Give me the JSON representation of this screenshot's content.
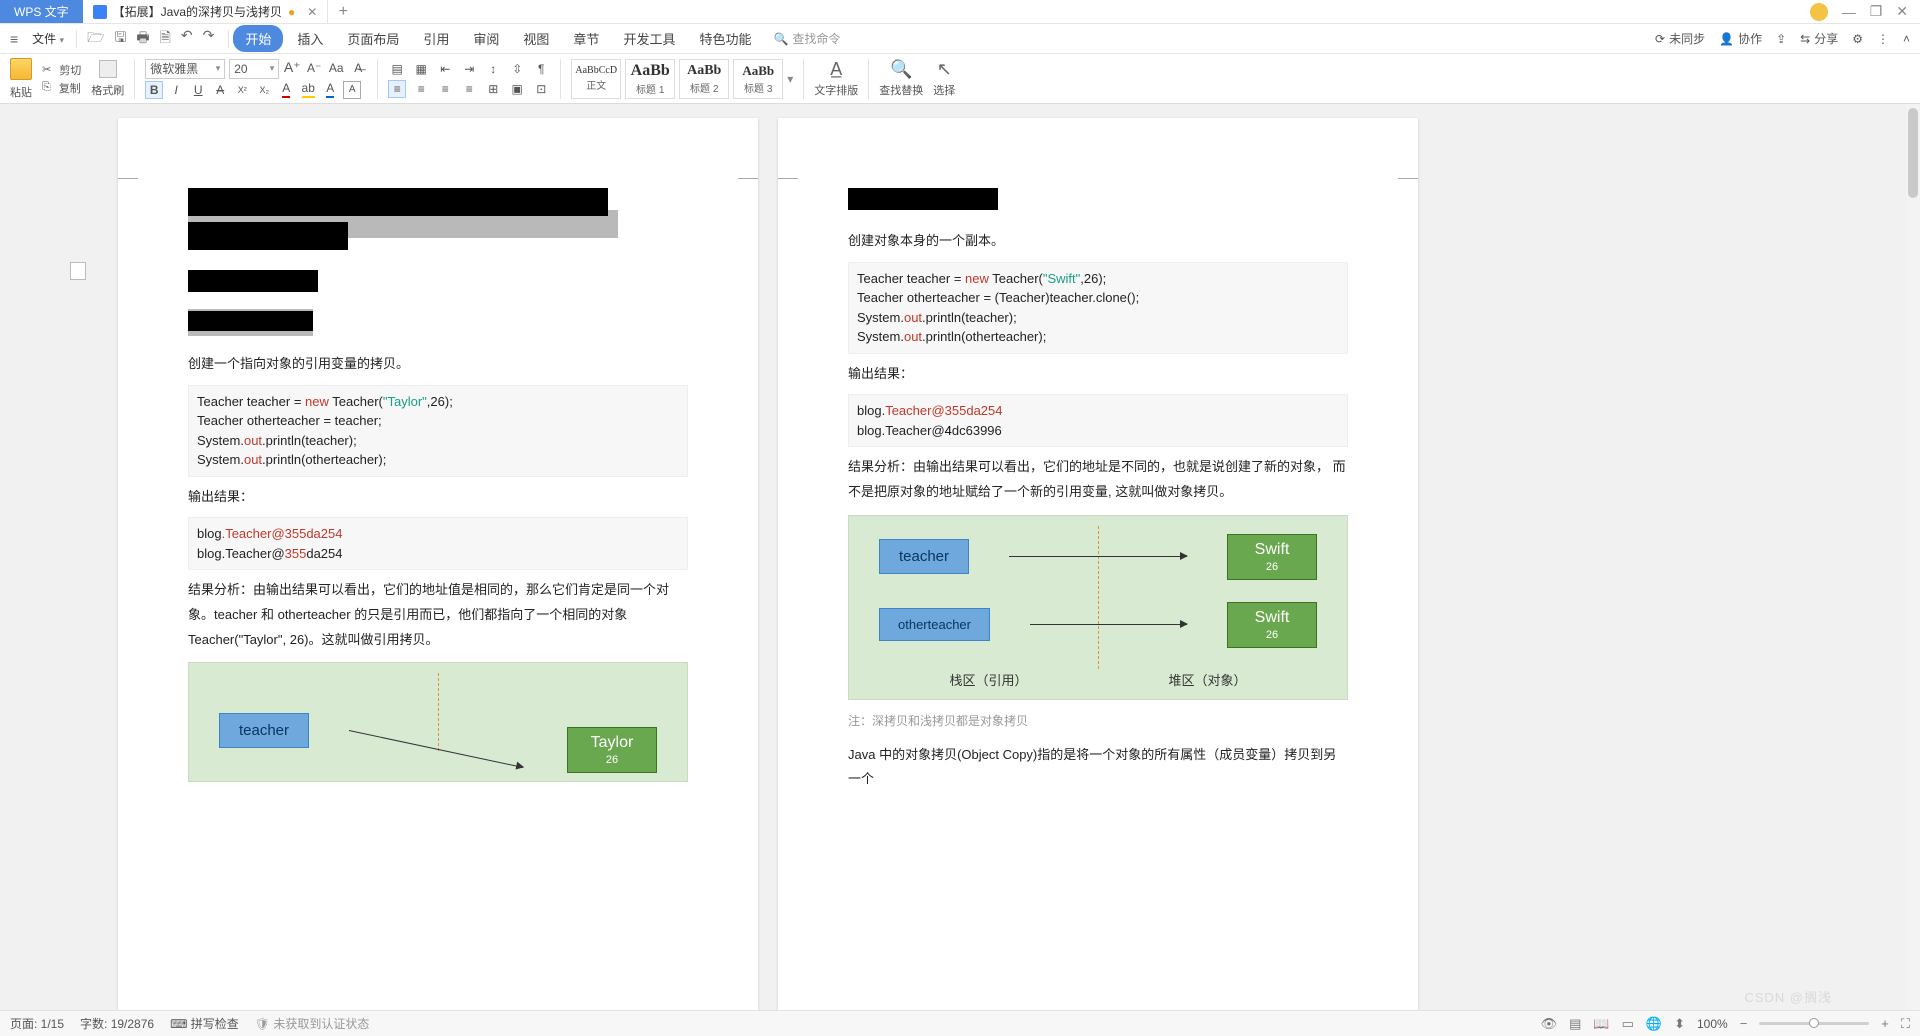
{
  "titlebar": {
    "app_name": "WPS 文字",
    "doc_title": "【拓展】Java的深拷贝与浅拷贝",
    "doc_dirty": "●"
  },
  "menubar": {
    "file": "文件",
    "tabs": [
      "开始",
      "插入",
      "页面布局",
      "引用",
      "审阅",
      "视图",
      "章节",
      "开发工具",
      "特色功能"
    ],
    "search_placeholder": "查找命令",
    "right": {
      "sync": "未同步",
      "collab": "协作",
      "share": "分享"
    }
  },
  "ribbon": {
    "paste": "粘贴",
    "cut": "剪切",
    "copy": "复制",
    "format_brush": "格式刷",
    "font_name": "微软雅黑",
    "font_size": "20",
    "styles": [
      {
        "preview": "AaBbCcD",
        "name": "正文"
      },
      {
        "preview": "AaBb",
        "name": "标题 1"
      },
      {
        "preview": "AaBb",
        "name": "标题 2"
      },
      {
        "preview": "AaBb",
        "name": "标题 3"
      }
    ],
    "text_layout": "文字排版",
    "find_replace": "查找替换",
    "select": "选择"
  },
  "doc": {
    "left": {
      "p1": "创建一个指向对象的引用变量的拷贝。",
      "code": [
        "Teacher teacher = new Teacher(\"Taylor\",26);",
        "Teacher otherteacher = teacher;",
        "System.out.println(teacher);",
        "System.out.println(otherteacher);"
      ],
      "out_label": "输出结果：",
      "out": [
        "blog.Teacher@355da254",
        "blog.Teacher@355da254"
      ],
      "analysis": "结果分析：由输出结果可以看出，它们的地址值是相同的，那么它们肯定是同一个对象。teacher 和 otherteacher 的只是引用而已，他们都指向了一个相同的对象 Teacher(\"Taylor\", 26)。这就叫做引用拷贝。",
      "diagram": {
        "ref": "teacher",
        "obj_name": "Taylor",
        "obj_age": "26"
      }
    },
    "right": {
      "p1": "创建对象本身的一个副本。",
      "code": [
        "Teacher teacher = new Teacher(\"Swift\",26);",
        "Teacher otherteacher = (Teacher)teacher.clone();",
        "System.out.println(teacher);",
        "System.out.println(otherteacher);"
      ],
      "out_label": "输出结果：",
      "out": [
        "blog.Teacher@355da254",
        "blog.Teacher@4dc63996"
      ],
      "analysis": "结果分析：由输出结果可以看出，它们的地址是不同的，也就是说创建了新的对象，  而不是把原对象的地址赋给了一个新的引用变量, 这就叫做对象拷贝。",
      "diagram": {
        "ref1": "teacher",
        "ref2": "otherteacher",
        "obj_name": "Swift",
        "obj_age": "26",
        "stack_label": "栈区（引用）",
        "heap_label": "堆区（对象）"
      },
      "note": "注：深拷贝和浅拷贝都是对象拷贝",
      "p2": "Java 中的对象拷贝(Object Copy)指的是将一个对象的所有属性（成员变量）拷贝到另一个"
    }
  },
  "status": {
    "page": "页面: 1/15",
    "words": "字数: 19/2876",
    "spell": "拼写检查",
    "auth": "未获取到认证状态",
    "zoom": "100%",
    "watermark": "CSDN @搁浅"
  }
}
